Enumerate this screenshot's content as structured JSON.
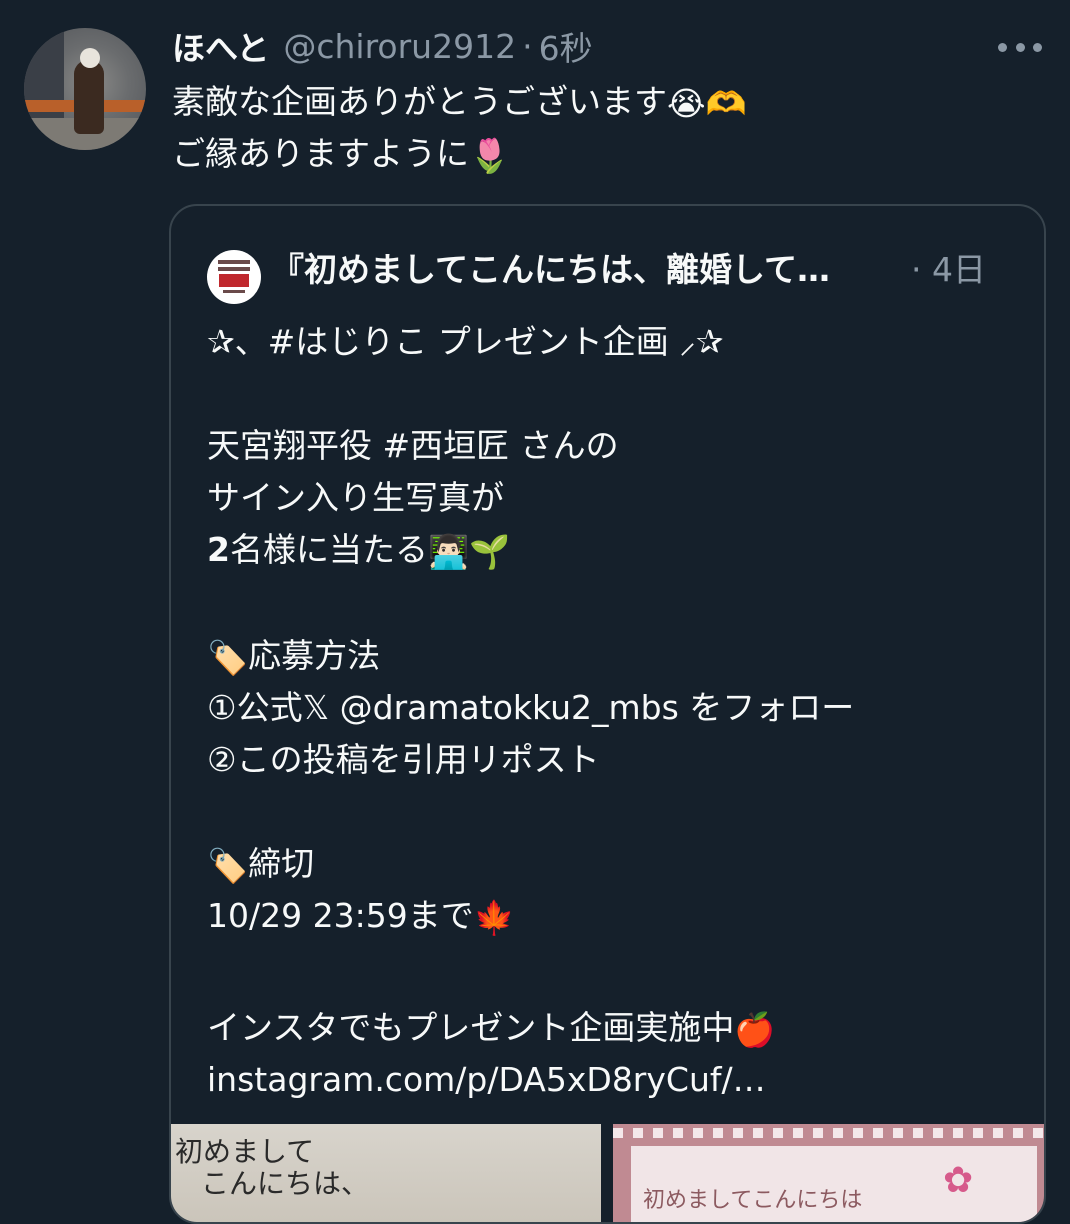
{
  "author": {
    "display_name": "ほへと",
    "handle": "@chiroru2912",
    "separator": "·",
    "timestamp": "6秒"
  },
  "tweet": {
    "line1_text": "素敵な企画ありがとうございます",
    "line1_emoji1": "😭",
    "line1_emoji2": "🫶",
    "line2_text": "ご縁ありますように",
    "line2_emoji": "🌷"
  },
  "quote": {
    "title": "『初めましてこんにちは、離婚して…",
    "separator": "·",
    "timestamp": "4日",
    "avatar_logo_text": "初めましてこんにちは、離婚してください",
    "lines": {
      "l1": "✰、#はじりこ プレゼント企画 ⸝✰",
      "l3": "天宮翔平役 #西垣匠 さんの",
      "l4": "サイン入り生写真が",
      "l5_bold": "2",
      "l5_text": "名様に当たる",
      "l5_emoji1": "👨🏻‍💻",
      "l5_emoji2": "🌱",
      "l7_emoji": "🏷️",
      "l7_text": "応募方法",
      "l8": "①公式𝕏 @dramatokku2_mbs をフォロー",
      "l9": "②この投稿を引用リポスト",
      "l11_emoji": "🏷️",
      "l11_text": "締切",
      "l12_text": "10/29 23:59まで",
      "l12_emoji": "🍁",
      "l14_text": "インスタでもプレゼント企画実施中",
      "l14_emoji": "🍎",
      "l15": "instagram.com/p/DA5xD8ryCuf/…"
    },
    "media_left_text_1": "初めまして",
    "media_left_text_2": "こんにちは、",
    "media_right_text": "初めましてこんにちは",
    "media_right_flower": "✿"
  },
  "icons": {
    "more": "more-icon"
  },
  "colors": {
    "background": "#15202b",
    "text_primary": "#f7f9f9",
    "text_secondary": "#8b98a5",
    "border": "#38444d"
  }
}
